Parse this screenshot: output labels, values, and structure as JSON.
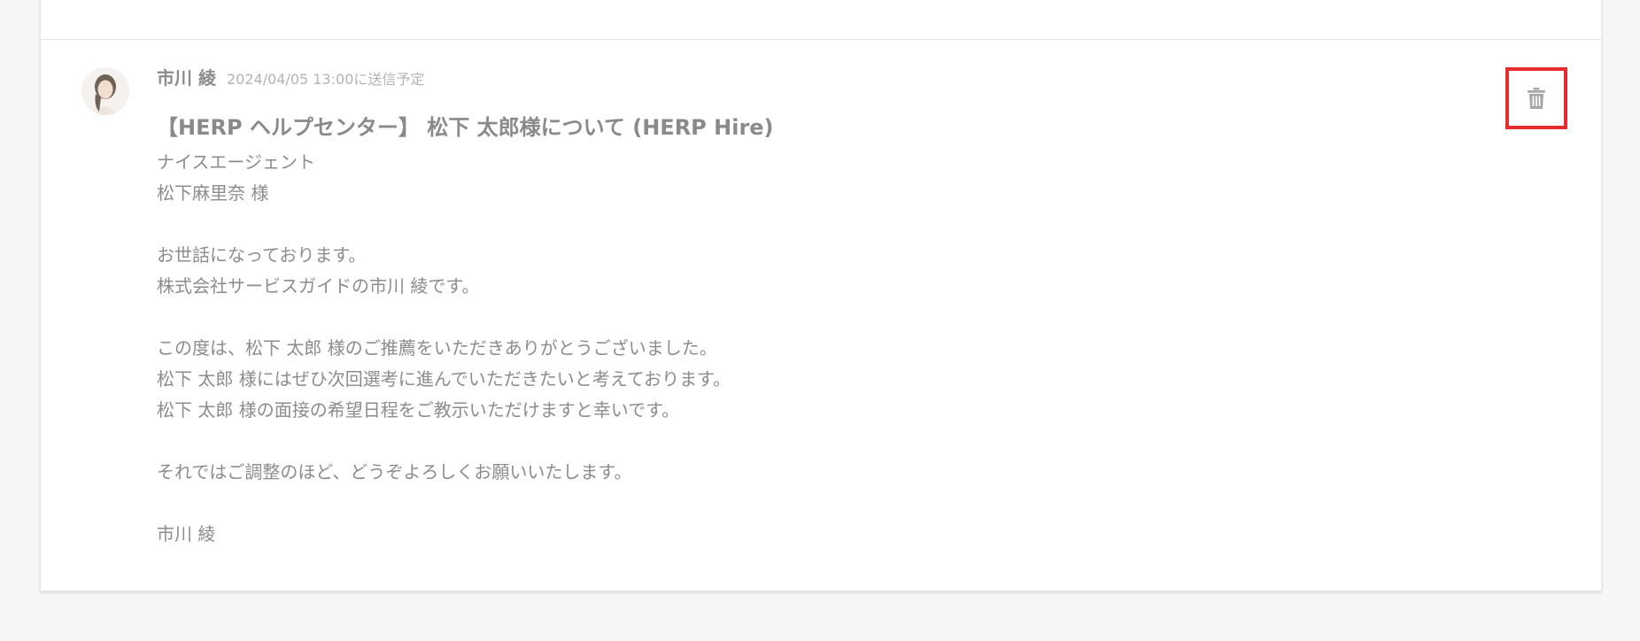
{
  "message": {
    "sender_name": "市川 綾",
    "scheduled_text": "2024/04/05 13:00に送信予定",
    "subject": "【HERP ヘルプセンター】 松下 太郎様について (HERP Hire)",
    "body_lines": [
      "ナイスエージェント",
      "松下麻里奈 様",
      "",
      "お世話になっております。",
      "株式会社サービスガイドの市川 綾です。",
      "",
      "この度は、松下 太郎 様のご推薦をいただきありがとうございました。",
      "松下 太郎 様にはぜひ次回選考に進んでいただきたいと考えております。",
      "松下 太郎 様の面接の希望日程をご教示いただけますと幸いです。",
      "",
      "それではご調整のほど、どうぞよろしくお願いいたします。",
      "",
      "市川 綾"
    ]
  },
  "icons": {
    "delete": "trash-icon",
    "avatar": "avatar-photo"
  },
  "colors": {
    "highlight": "#e52d2d",
    "text": "#8c8c8c",
    "muted": "#b3b3b3"
  }
}
